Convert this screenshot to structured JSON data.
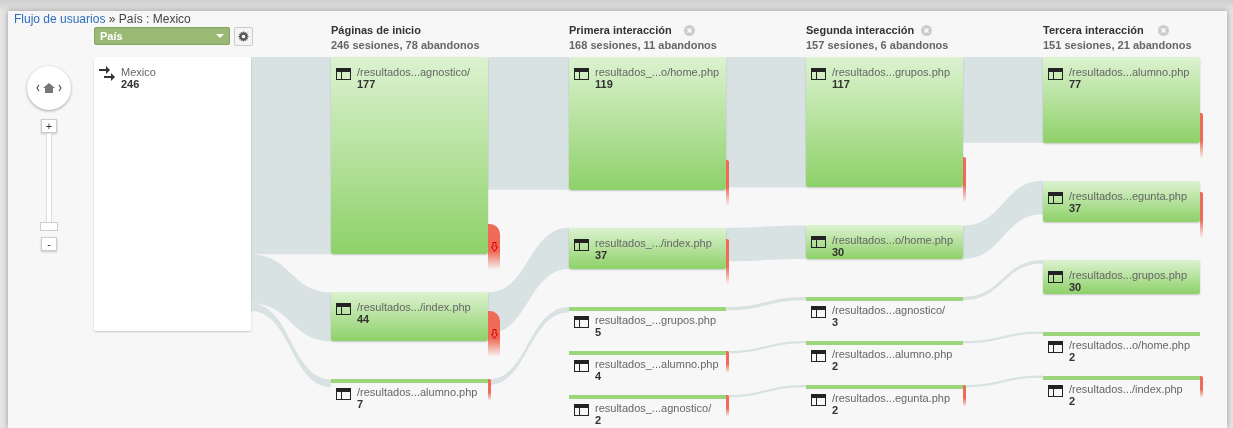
{
  "breadcrumb": {
    "link": "Flujo de usuarios",
    "separator": "»",
    "current": "País : Mexico"
  },
  "dimension_select": {
    "value": "País"
  },
  "zoom": {
    "level": 0,
    "in_label": "+",
    "out_label": "-"
  },
  "root": {
    "label": "Mexico",
    "count": "246"
  },
  "columns": [
    {
      "title": "Páginas de inicio",
      "summary": "246 sesiones, 78 abandonos",
      "closable": false,
      "nodes": [
        {
          "label": "/resultados...agnostico/",
          "count": "177",
          "dropoff": true
        },
        {
          "label": "/resultados.../index.php",
          "count": "44",
          "dropoff": true
        },
        {
          "label": "/resultados...alumno.php",
          "count": "7",
          "dropoff": true
        }
      ]
    },
    {
      "title": "Primera interacción",
      "summary": "168 sesiones, 11 abandonos",
      "closable": true,
      "nodes": [
        {
          "label": "resultados_...o/home.php",
          "count": "119",
          "dropoff": true
        },
        {
          "label": "resultados_.../index.php",
          "count": "37",
          "dropoff": true
        },
        {
          "label": "resultados_...grupos.php",
          "count": "5",
          "dropoff": false
        },
        {
          "label": "resultados_...alumno.php",
          "count": "4",
          "dropoff": true
        },
        {
          "label": "resultados_...agnostico/",
          "count": "2",
          "dropoff": true
        }
      ]
    },
    {
      "title": "Segunda interacción",
      "summary": "157 sesiones, 6 abandonos",
      "closable": true,
      "nodes": [
        {
          "label": "/resultados...grupos.php",
          "count": "117",
          "dropoff": true
        },
        {
          "label": "/resultados...o/home.php",
          "count": "30",
          "dropoff": false
        },
        {
          "label": "/resultados...agnostico/",
          "count": "3",
          "dropoff": false
        },
        {
          "label": "/resultados...alumno.php",
          "count": "2",
          "dropoff": false
        },
        {
          "label": "/resultados...egunta.php",
          "count": "2",
          "dropoff": true
        }
      ]
    },
    {
      "title": "Tercera interacción",
      "summary": "151 sesiones, 21 abandonos",
      "closable": true,
      "nodes": [
        {
          "label": "/resultados...alumno.php",
          "count": "77",
          "dropoff": true
        },
        {
          "label": "/resultados...egunta.php",
          "count": "37",
          "dropoff": true
        },
        {
          "label": "/resultados...grupos.php",
          "count": "30",
          "dropoff": false
        },
        {
          "label": "/resultados...o/home.php",
          "count": "2",
          "dropoff": false
        },
        {
          "label": "/resultados.../index.php",
          "count": "2",
          "dropoff": true
        }
      ]
    }
  ]
}
